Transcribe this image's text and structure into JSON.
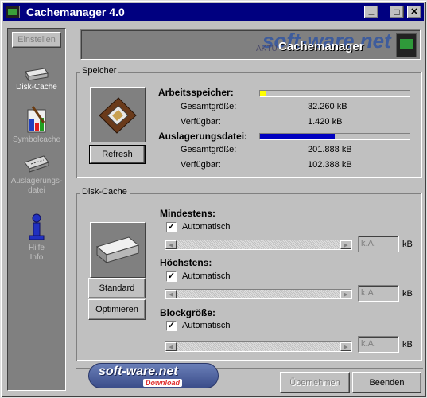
{
  "window": {
    "title": "Cachemanager 4.0",
    "controls": {
      "minimize": "_",
      "maximize": "□",
      "close": "×"
    }
  },
  "banner": {
    "logo": "soft-ware.net",
    "subtitle": "AKTU",
    "title": "Cachemanager"
  },
  "sidebar": {
    "settings_button": "Einstellen",
    "items": [
      {
        "label": "Disk-Cache",
        "icon": "disk-drive-icon",
        "state": "active"
      },
      {
        "label": "Symbolcache",
        "icon": "paintbrush-icon",
        "state": "disabled"
      },
      {
        "label": "Auslagerungs-\ndatei",
        "icon": "memory-module-icon",
        "state": "disabled"
      },
      {
        "label": "Hilfe\nInfo",
        "icon": "info-person-icon",
        "state": "disabled"
      }
    ]
  },
  "speicher": {
    "group_title": "Speicher",
    "refresh_button": "Refresh",
    "ram": {
      "label": "Arbeitsspeicher:",
      "total_label": "Gesamtgröße:",
      "total_value": "32.260 kB",
      "free_label": "Verfügbar:",
      "free_value": "1.420 kB",
      "fill_fraction": 0.04,
      "fill_color": "#ffff00"
    },
    "swap": {
      "label": "Auslagerungsdatei:",
      "total_label": "Gesamtgröße:",
      "total_value": "201.888 kB",
      "free_label": "Verfügbar:",
      "free_value": "102.388 kB",
      "fill_fraction": 0.5,
      "fill_color": "#0000c0"
    }
  },
  "disk_cache": {
    "group_title": "Disk-Cache",
    "standard_button": "Standard",
    "optimize_button": "Optimieren",
    "settings": [
      {
        "title": "Mindestens:",
        "checkbox_label": "Automatisch",
        "checked": true,
        "value_placeholder": "k.A.",
        "unit": "kB"
      },
      {
        "title": "Höchstens:",
        "checkbox_label": "Automatisch",
        "checked": true,
        "value_placeholder": "k.A.",
        "unit": "kB"
      },
      {
        "title": "Blockgröße:",
        "checkbox_label": "Automatisch",
        "checked": true,
        "value_placeholder": "k.A.",
        "unit": "kB"
      }
    ]
  },
  "footer": {
    "apply_button": "Übernehmen",
    "exit_button": "Beenden"
  },
  "watermark": {
    "main": "soft-ware.net",
    "sub": "Download"
  },
  "check_mark": "✓",
  "arrow_left": "◀",
  "arrow_right": "▶"
}
